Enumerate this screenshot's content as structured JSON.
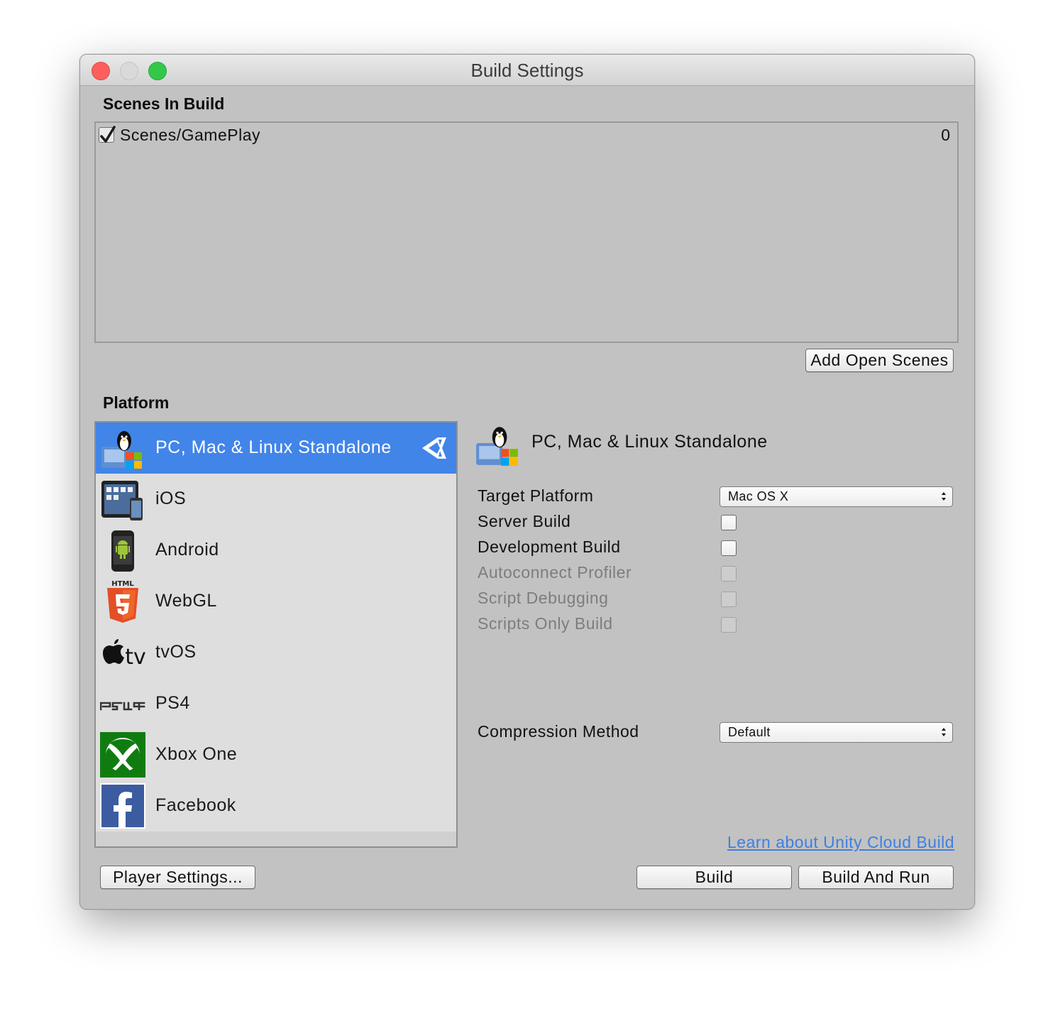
{
  "window": {
    "title": "Build Settings"
  },
  "scenes": {
    "heading": "Scenes In Build",
    "items": [
      {
        "name": "Scenes/GamePlay",
        "checked": true,
        "index": "0"
      }
    ],
    "add_open_scenes_label": "Add Open Scenes"
  },
  "platform": {
    "heading": "Platform",
    "selected": "PC, Mac & Linux Standalone",
    "items": [
      {
        "label": "PC, Mac & Linux Standalone",
        "icon": "standalone-icon"
      },
      {
        "label": "iOS",
        "icon": "ios-device-icon"
      },
      {
        "label": "Android",
        "icon": "android-phone-icon"
      },
      {
        "label": "WebGL",
        "icon": "html5-icon"
      },
      {
        "label": "tvOS",
        "icon": "apple-tv-icon"
      },
      {
        "label": "PS4",
        "icon": "ps4-logo-icon"
      },
      {
        "label": "Xbox One",
        "icon": "xbox-logo-icon"
      },
      {
        "label": "Facebook",
        "icon": "facebook-logo-icon"
      }
    ]
  },
  "details": {
    "title": "PC, Mac & Linux Standalone",
    "target_platform_label": "Target Platform",
    "target_platform_value": "Mac OS X",
    "server_build_label": "Server Build",
    "server_build_checked": false,
    "development_build_label": "Development Build",
    "development_build_checked": false,
    "autoconnect_profiler_label": "Autoconnect Profiler",
    "script_debugging_label": "Script Debugging",
    "scripts_only_build_label": "Scripts Only Build",
    "compression_method_label": "Compression Method",
    "compression_method_value": "Default",
    "cloud_build_link": "Learn about Unity Cloud Build"
  },
  "footer": {
    "player_settings_label": "Player Settings...",
    "build_label": "Build",
    "build_and_run_label": "Build And Run"
  },
  "colors": {
    "window_bg": "#c2c2c2",
    "selection": "#4285e8",
    "link": "#3f7fe0",
    "close": "#fc605c",
    "maximize": "#34c84a"
  }
}
